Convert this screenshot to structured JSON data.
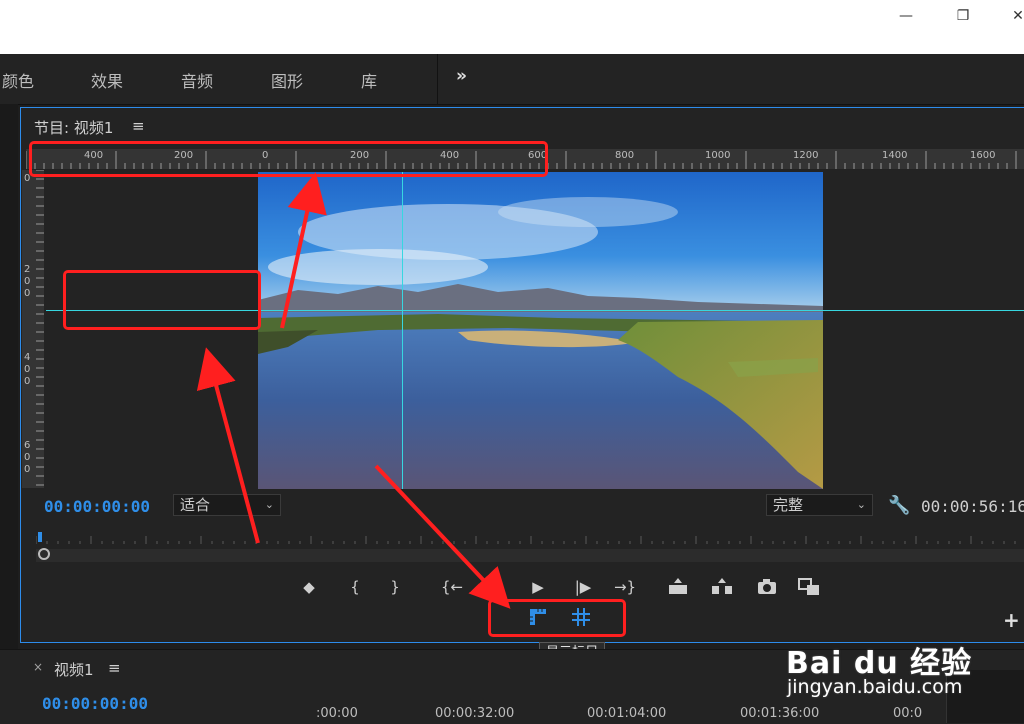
{
  "window": {
    "minimize_glyph": "—",
    "restore_glyph": "❐",
    "close_glyph": "✕"
  },
  "menu": {
    "items": [
      "颜色",
      "效果",
      "音频",
      "图形",
      "库"
    ],
    "overflow": "»"
  },
  "program_monitor": {
    "title": "节目: 视频1",
    "menu_glyph": "≡",
    "ruler_h_labels": [
      "400",
      "200",
      "0",
      "200",
      "400",
      "600",
      "800",
      "1000",
      "1200",
      "1400",
      "1600"
    ],
    "ruler_v_labels": [
      "0",
      "2\n0\n0",
      "4\n0\n0",
      "6\n0\n0"
    ],
    "timecode": "00:00:00:00",
    "fit_select": "适合",
    "quality_select": "完整",
    "duration": "00:00:56:16",
    "tooltip": "显示标尺"
  },
  "transport": {
    "marker": "◆",
    "mark_in": "{",
    "mark_out": "}",
    "goto_in": "{←",
    "step_back": "◀|",
    "play": "▶",
    "step_forward": "|▶",
    "goto_out": "→}"
  },
  "timeline": {
    "close": "×",
    "title": "视频1",
    "menu_glyph": "≡",
    "timecode": "00:00:00:00",
    "marks": [
      ":00:00",
      "00:00:32:00",
      "00:01:04:00",
      "00:01:36:00",
      "00:0"
    ]
  },
  "watermark": {
    "brand": "Bai du 经验",
    "url": "jingyan.baidu.com"
  },
  "colors": {
    "accent_blue": "#2f8ee8",
    "annotation_red": "#ff1f1f",
    "guide_cyan": "#37d7e0",
    "panel_bg": "#232323"
  }
}
